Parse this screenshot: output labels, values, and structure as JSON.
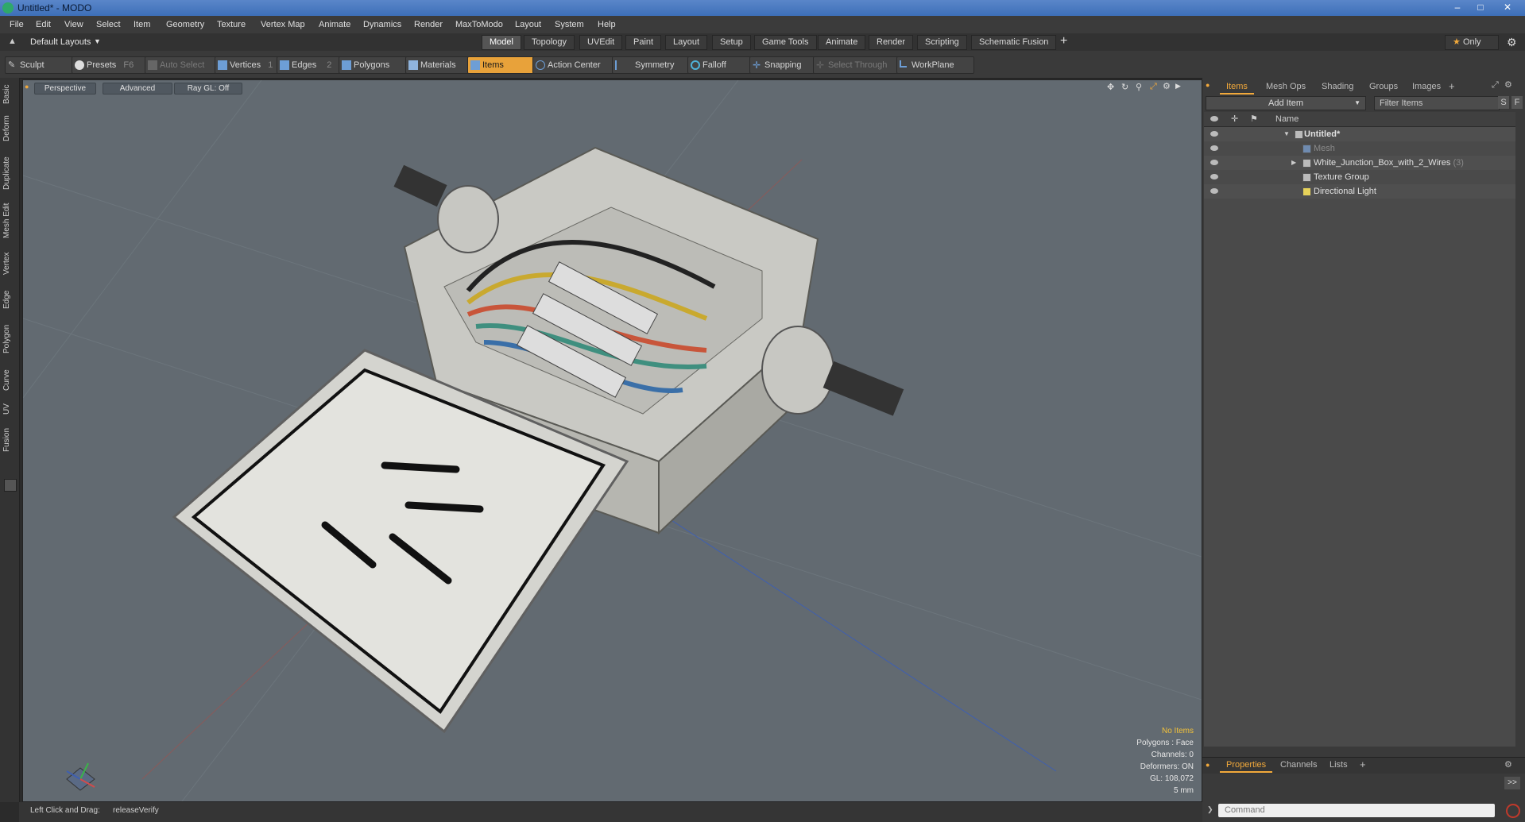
{
  "window": {
    "title": "Untitled* - MODO"
  },
  "menus": [
    "File",
    "Edit",
    "View",
    "Select",
    "Item",
    "Geometry",
    "Texture",
    "Vertex Map",
    "Animate",
    "Dynamics",
    "Render",
    "MaxToModo",
    "Layout",
    "System",
    "Help"
  ],
  "layout_selector": "Default Layouts",
  "layout_tabs": [
    "Model",
    "Topology",
    "UVEdit",
    "Paint",
    "Layout",
    "Setup",
    "Game Tools",
    "Animate",
    "Render",
    "Scripting",
    "Schematic Fusion"
  ],
  "only_toggle": "Only",
  "toolbar": {
    "sculpt": "Sculpt",
    "presets": "Presets",
    "presets_key": "F6",
    "auto_select": "Auto Select",
    "vertices": "Vertices",
    "vertices_count": "1",
    "edges": "Edges",
    "edges_count": "2",
    "polygons": "Polygons",
    "materials": "Materials",
    "items": "Items",
    "action_center": "Action Center",
    "symmetry": "Symmetry",
    "falloff": "Falloff",
    "snapping": "Snapping",
    "select_through": "Select Through",
    "workplane": "WorkPlane"
  },
  "side_tabs": [
    "Basic",
    "Deform",
    "Duplicate",
    "Mesh Edit",
    "Vertex",
    "Edge",
    "Polygon",
    "Curve",
    "UV",
    "Fusion"
  ],
  "viewport": {
    "view": "Perspective",
    "mode": "Advanced",
    "raygl": "Ray GL: Off",
    "info": {
      "items": "No Items",
      "polygons": "Polygons : Face",
      "channels": "Channels: 0",
      "deformers": "Deformers: ON",
      "gl": "GL: 108,072",
      "scale": "5 mm"
    }
  },
  "right_panel": {
    "tabs": [
      "Items",
      "Mesh Ops",
      "Shading",
      "Groups",
      "Images"
    ],
    "add_item": "Add Item",
    "filter": "Filter Items",
    "filter_s": "S",
    "filter_f": "F",
    "column_name": "Name",
    "tree": [
      {
        "label": "Untitled*",
        "bold": true
      },
      {
        "label": "Mesh",
        "dim": true
      },
      {
        "label": "White_Junction_Box_with_2_Wires",
        "count": "(3)"
      },
      {
        "label": "Texture Group"
      },
      {
        "label": "Directional Light"
      }
    ],
    "bottom_tabs": [
      "Properties",
      "Channels",
      "Lists"
    ],
    "expand": ">>",
    "command_placeholder": "Command"
  },
  "status": {
    "hint_label": "Left Click and Drag:",
    "hint_value": "releaseVerify"
  },
  "colors": {
    "accent": "#e8a23a",
    "viewport": "#626a71",
    "warn": "#f3c23a"
  }
}
